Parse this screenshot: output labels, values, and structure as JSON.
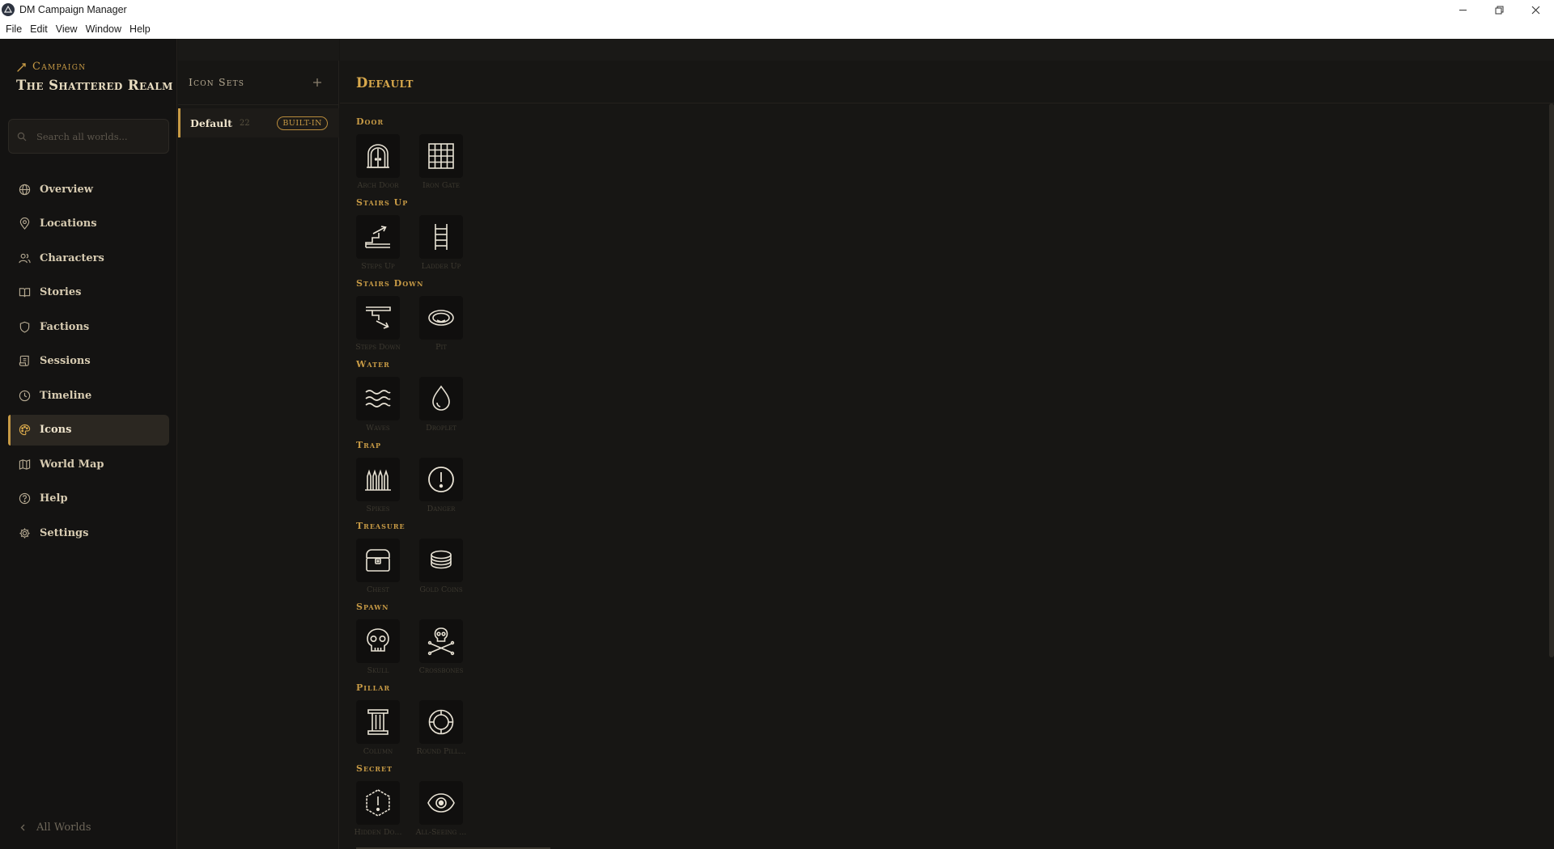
{
  "window": {
    "title": "DM Campaign Manager"
  },
  "menu": [
    "File",
    "Edit",
    "View",
    "Window",
    "Help"
  ],
  "sidebar": {
    "campaign_label": "Campaign",
    "campaign_name": "The Shattered Realm",
    "search_placeholder": "Search all worlds...",
    "nav": [
      {
        "label": "Overview",
        "icon": "globe-icon"
      },
      {
        "label": "Locations",
        "icon": "map-pin-icon"
      },
      {
        "label": "Characters",
        "icon": "users-icon"
      },
      {
        "label": "Stories",
        "icon": "book-icon"
      },
      {
        "label": "Factions",
        "icon": "shield-icon"
      },
      {
        "label": "Sessions",
        "icon": "scroll-icon"
      },
      {
        "label": "Timeline",
        "icon": "clock-icon"
      },
      {
        "label": "Icons",
        "icon": "palette-icon",
        "active": true
      },
      {
        "label": "World Map",
        "icon": "map-icon"
      },
      {
        "label": "Help",
        "icon": "help-icon"
      },
      {
        "label": "Settings",
        "icon": "gear-icon"
      }
    ],
    "back_label": "All Worlds"
  },
  "sets_panel": {
    "header": "Icon Sets",
    "items": [
      {
        "name": "Default",
        "count": "22",
        "badge": "BUILT-IN"
      }
    ]
  },
  "main": {
    "title": "Default",
    "categories": [
      {
        "label": "Door",
        "icons": [
          {
            "name": "Arch Door",
            "icon": "arch-door-icon"
          },
          {
            "name": "Iron Gate",
            "icon": "iron-gate-icon"
          }
        ]
      },
      {
        "label": "Stairs Up",
        "icons": [
          {
            "name": "Steps Up",
            "icon": "steps-up-icon"
          },
          {
            "name": "Ladder Up",
            "icon": "ladder-icon"
          }
        ]
      },
      {
        "label": "Stairs Down",
        "icons": [
          {
            "name": "Steps Down",
            "icon": "steps-down-icon"
          },
          {
            "name": "Pit",
            "icon": "pit-icon"
          }
        ]
      },
      {
        "label": "Water",
        "icons": [
          {
            "name": "Waves",
            "icon": "waves-icon"
          },
          {
            "name": "Droplet",
            "icon": "droplet-icon"
          }
        ]
      },
      {
        "label": "Trap",
        "icons": [
          {
            "name": "Spikes",
            "icon": "spikes-icon"
          },
          {
            "name": "Danger",
            "icon": "danger-icon"
          }
        ]
      },
      {
        "label": "Treasure",
        "icons": [
          {
            "name": "Chest",
            "icon": "chest-icon"
          },
          {
            "name": "Gold Coins",
            "icon": "coins-icon"
          }
        ]
      },
      {
        "label": "Spawn",
        "icons": [
          {
            "name": "Skull",
            "icon": "skull-icon"
          },
          {
            "name": "Crossbones",
            "icon": "crossbones-icon"
          }
        ]
      },
      {
        "label": "Pillar",
        "icons": [
          {
            "name": "Column",
            "icon": "column-icon"
          },
          {
            "name": "Round Pill...",
            "icon": "round-pillar-icon"
          }
        ]
      },
      {
        "label": "Secret",
        "icons": [
          {
            "name": "Hidden Do...",
            "icon": "hidden-door-icon"
          },
          {
            "name": "All-Seeing ...",
            "icon": "eye-icon"
          }
        ]
      }
    ]
  },
  "colors": {
    "accent": "#c79a45",
    "background": "#161513",
    "sidebar": "#141312",
    "text": "#d7cbb1"
  }
}
